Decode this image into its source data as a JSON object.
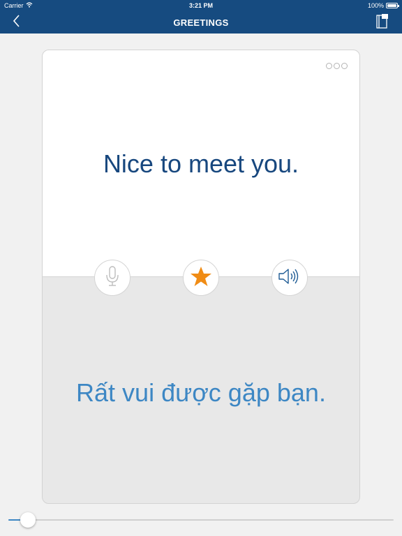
{
  "status_bar": {
    "carrier": "Carrier",
    "time": "3:21 PM",
    "battery": "100%"
  },
  "nav": {
    "title": "GREETINGS",
    "back_icon": "chevron-left-icon",
    "book_icon": "phrasebook-icon"
  },
  "card": {
    "phrase_english": "Nice to meet you.",
    "phrase_vietnamese": "Rất vui được gặp bạn.",
    "more_icon": "more-options-icon",
    "mic_icon": "microphone-icon",
    "favorite_icon": "star-icon",
    "favorite_active": true,
    "speaker_icon": "speaker-icon"
  },
  "progress": {
    "fraction": 0.05
  },
  "colors": {
    "header": "#164b80",
    "english_text": "#17477e",
    "vietnamese_text": "#3d87c4",
    "star": "#f08c15"
  }
}
